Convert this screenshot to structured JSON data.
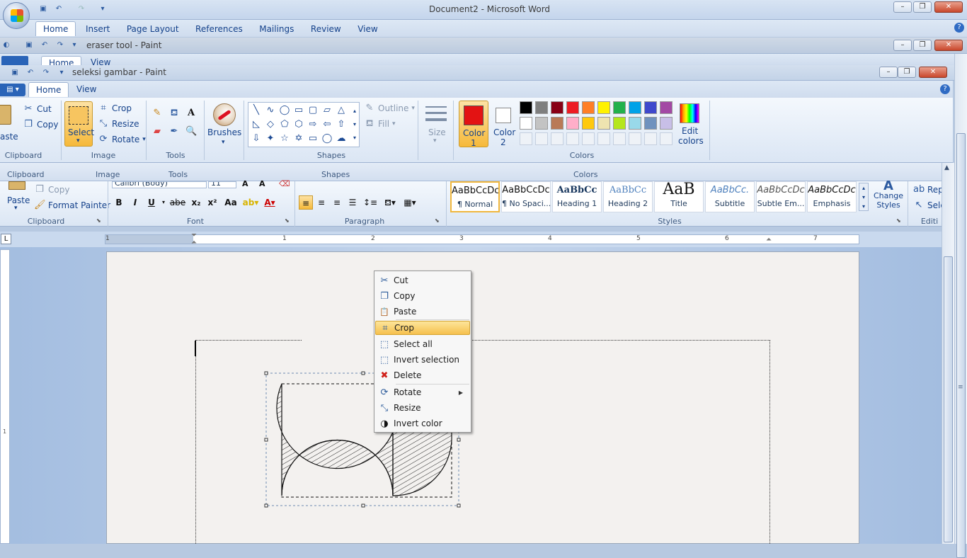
{
  "word": {
    "title": "Document2 - Microsoft Word",
    "tabs": [
      "Home",
      "Insert",
      "Page Layout",
      "References",
      "Mailings",
      "Review",
      "View"
    ],
    "clipboard": {
      "paste": "Paste",
      "copy": "Copy",
      "format_painter": "Format Painter",
      "label": "Clipboard"
    },
    "font": {
      "name": "Calibri (Body)",
      "size": "11",
      "label": "Font",
      "buttons": [
        "B",
        "I",
        "U",
        "abe",
        "x₂",
        "x²",
        "Aa"
      ]
    },
    "paragraph": {
      "label": "Paragraph"
    },
    "styles": {
      "label": "Styles",
      "items": [
        {
          "preview": "AaBbCcDc",
          "name": "¶ Normal"
        },
        {
          "preview": "AaBbCcDc",
          "name": "¶ No Spaci..."
        },
        {
          "preview": "AaBbCc",
          "name": "Heading 1"
        },
        {
          "preview": "AaBbCc",
          "name": "Heading 2"
        },
        {
          "preview": "AaB",
          "name": "Title"
        },
        {
          "preview": "AaBbCc.",
          "name": "Subtitle"
        },
        {
          "preview": "AaBbCcDc",
          "name": "Subtle Em..."
        },
        {
          "preview": "AaBbCcDc",
          "name": "Emphasis"
        }
      ],
      "change_styles": "Change Styles"
    },
    "editing": {
      "label": "Editi",
      "replace": "Rep",
      "select": "Sele"
    },
    "ruler": [
      "1",
      "1",
      "2",
      "3",
      "4",
      "5",
      "6",
      "7"
    ]
  },
  "paint1": {
    "title": "eraser tool - Paint",
    "tabs": [
      "Home",
      "View"
    ]
  },
  "paint2": {
    "title": "seleksi gambar - Paint",
    "tabs": [
      "Home",
      "View"
    ],
    "clipboard": {
      "paste": "aste",
      "cut": "Cut",
      "copy": "Copy",
      "label": "Clipboard"
    },
    "image": {
      "select": "Select",
      "crop": "Crop",
      "resize": "Resize",
      "rotate": "Rotate",
      "label": "Image"
    },
    "tools": {
      "label": "Tools"
    },
    "brushes": "Brushes",
    "shapes": {
      "outline": "Outline",
      "fill": "Fill",
      "label": "Shapes"
    },
    "size": "Size",
    "color1": {
      "line1": "Color",
      "line2": "1",
      "value": "#e31313"
    },
    "color2": {
      "line1": "Color",
      "line2": "2",
      "value": "#ffffff"
    },
    "palette": [
      "#000000",
      "#7f7f7f",
      "#880015",
      "#ed1c24",
      "#ff7f27",
      "#fff200",
      "#22b14c",
      "#00a2e8",
      "#3f48cc",
      "#a349a4",
      "#ffffff",
      "#c3c3c3",
      "#b97a57",
      "#ffaec9",
      "#ffc90e",
      "#efe4b0",
      "#b5e61d",
      "#99d9ea",
      "#7092be",
      "#c8bfe7"
    ],
    "edit_colors": {
      "line1": "Edit",
      "line2": "colors"
    },
    "colors_label": "Colors"
  },
  "context_menu": {
    "items": [
      {
        "label": "Cut",
        "icon": "scissors-icon",
        "glyph": "✂"
      },
      {
        "label": "Copy",
        "icon": "copy-icon",
        "glyph": "❐"
      },
      {
        "label": "Paste",
        "icon": "paste-icon",
        "glyph": "📋"
      },
      {
        "label": "Crop",
        "icon": "crop-icon",
        "glyph": "⌗"
      },
      {
        "label": "Select all",
        "icon": "select-all-icon",
        "glyph": "⬚"
      },
      {
        "label": "Invert selection",
        "icon": "invert-selection-icon",
        "glyph": "⬚"
      },
      {
        "label": "Delete",
        "icon": "delete-icon",
        "glyph": "✖"
      },
      {
        "label": "Rotate",
        "icon": "rotate-icon",
        "glyph": "⟳"
      },
      {
        "label": "Resize",
        "icon": "resize-icon",
        "glyph": "⤡"
      },
      {
        "label": "Invert color",
        "icon": "invert-color-icon",
        "glyph": "◑"
      }
    ]
  }
}
